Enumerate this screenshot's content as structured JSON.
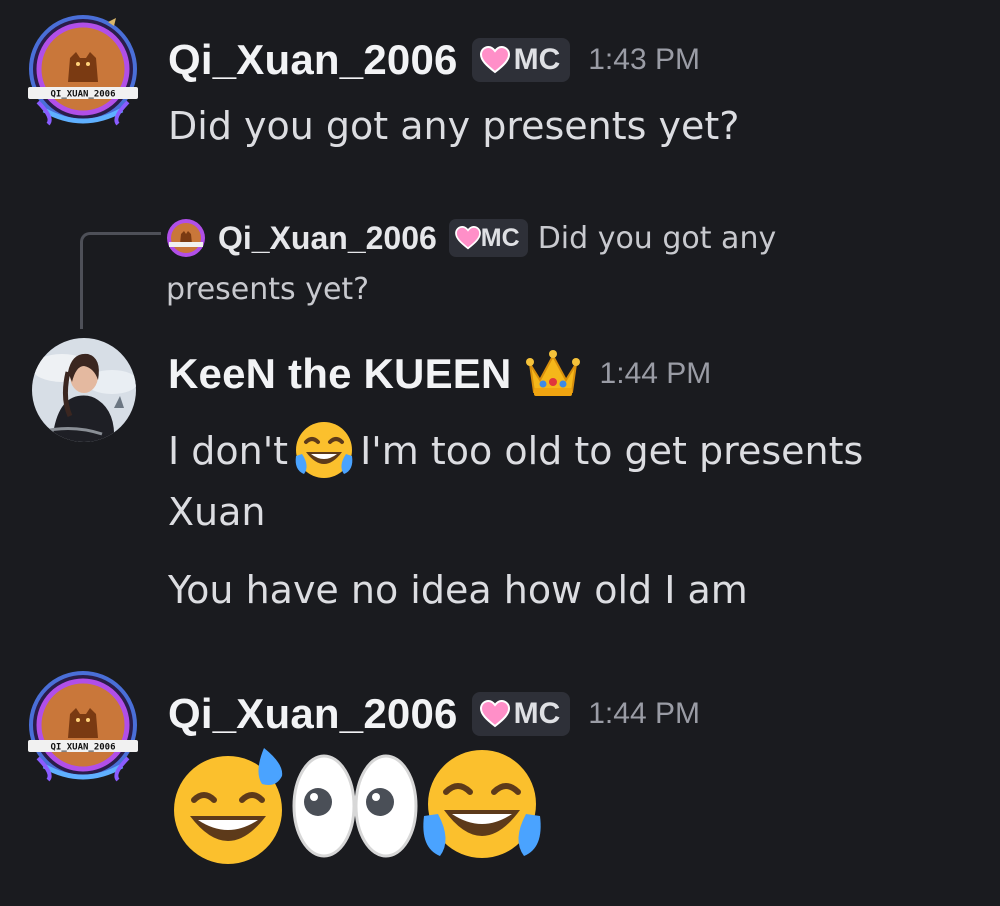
{
  "messages": [
    {
      "username": "Qi_Xuan_2006",
      "tag": "MC",
      "timestamp": "1:43 PM",
      "avatar_label": "QI_XUAN_2006",
      "text": "Did you got any presents yet?"
    },
    {
      "reply": {
        "username": "Qi_Xuan_2006",
        "tag": "MC",
        "text_line1": "Did you got any",
        "text_line2": "presents yet?"
      },
      "username": "KeeN the KUEEN",
      "badge_icon": "crown-icon",
      "timestamp": "1:44 PM",
      "lines": [
        {
          "before": "I don't",
          "emoji": "joy-emoji",
          "after": "I'm too old to get presents"
        },
        {
          "text": "Xuan"
        },
        {
          "text": "You have no idea how old I am"
        }
      ]
    },
    {
      "username": "Qi_Xuan_2006",
      "tag": "MC",
      "timestamp": "1:44 PM",
      "avatar_label": "QI_XUAN_2006",
      "emojis": [
        "sweat-smile-emoji",
        "eyes-emoji",
        "joy-emoji"
      ]
    }
  ],
  "colors": {
    "background": "#1a1b1f",
    "username": "#f2f3f5",
    "timestamp": "#9a9ca5",
    "tag_background": "#2e3038",
    "heart": "#ff8fc8"
  }
}
